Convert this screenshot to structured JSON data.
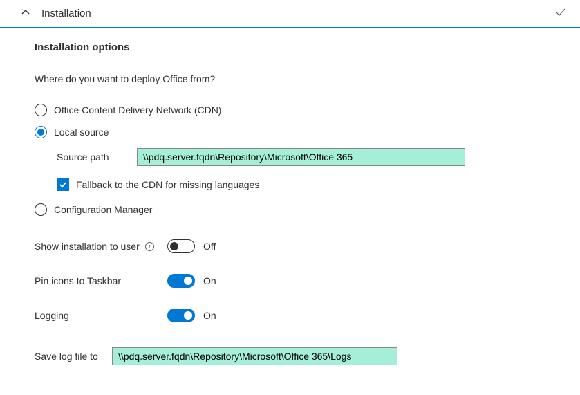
{
  "section": {
    "title": "Installation"
  },
  "options": {
    "heading": "Installation options",
    "question": "Where do you want to deploy Office from?",
    "radio_cdn": "Office Content Delivery Network (CDN)",
    "radio_local": "Local source",
    "radio_cfgmgr": "Configuration Manager",
    "source_path_label": "Source path",
    "source_path_value": "\\\\pdq.server.fqdn\\Repository\\Microsoft\\Office 365",
    "fallback_label": "Fallback to the CDN for missing languages"
  },
  "toggles": {
    "show_install_label": "Show installation to user",
    "show_install_state": "Off",
    "pin_label": "Pin icons to Taskbar",
    "pin_state": "On",
    "logging_label": "Logging",
    "logging_state": "On"
  },
  "log": {
    "label": "Save log file to",
    "value": "\\\\pdq.server.fqdn\\Repository\\Microsoft\\Office 365\\Logs"
  }
}
